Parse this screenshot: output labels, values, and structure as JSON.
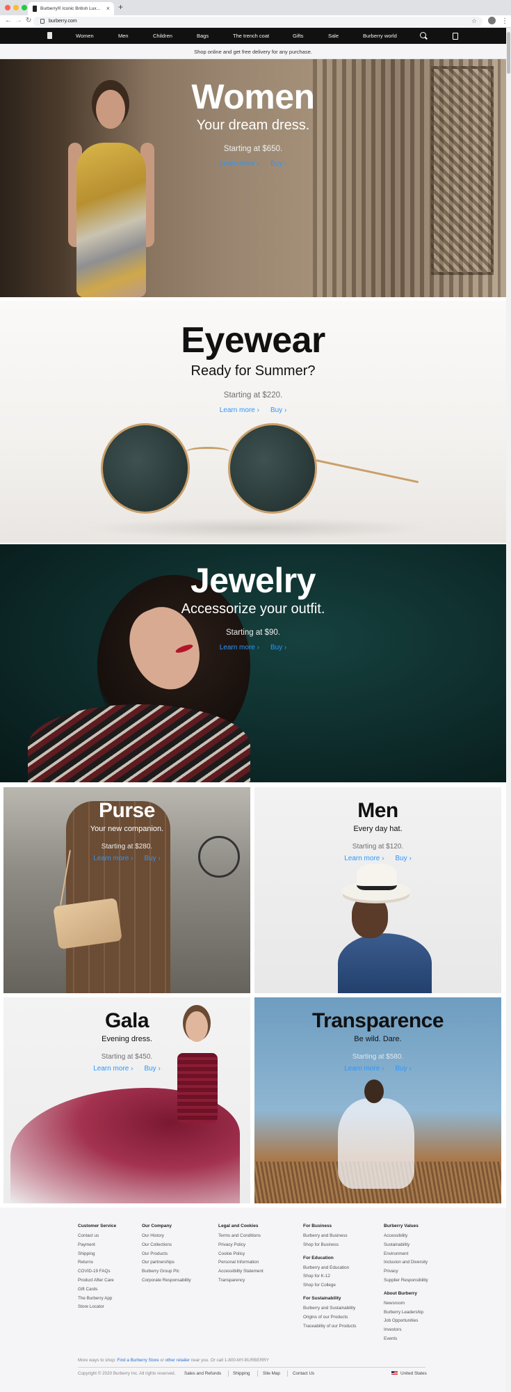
{
  "browser": {
    "tab_title": "Burberry® Iconic British Lux...",
    "url": "burberry.com",
    "traffic_light_colors": [
      "#ff5f57",
      "#febc2e",
      "#28c840"
    ],
    "icons": [
      "back-arrow-icon",
      "forward-arrow-icon",
      "reload-icon",
      "lock-icon",
      "star-icon",
      "profile-icon",
      "kebab-menu-icon"
    ]
  },
  "nav": {
    "items": [
      "Women",
      "Men",
      "Children",
      "Bags",
      "The trench coat",
      "Gifts",
      "Sale",
      "Burberry world"
    ],
    "icons": [
      "brand-logo-icon",
      "search-icon",
      "shopping-bag-icon"
    ]
  },
  "ribbon": "Shop online and get free delivery for any purchase.",
  "accent_color": "#2997ff",
  "heroes": [
    {
      "title": "Women",
      "subtitle": "Your dream dress.",
      "price": "Starting at $650.",
      "learn": "Learn more",
      "buy": "Buy"
    },
    {
      "title": "Eyewear",
      "subtitle": "Ready for Summer?",
      "price": "Starting at $220.",
      "learn": "Learn more",
      "buy": "Buy"
    },
    {
      "title": "Jewelry",
      "subtitle": "Accessorize your outfit.",
      "price": "Starting at $90.",
      "learn": "Learn more",
      "buy": "Buy"
    }
  ],
  "tiles": [
    {
      "title": "Purse",
      "subtitle": "Your new companion.",
      "price": "Starting at $280.",
      "learn": "Learn more",
      "buy": "Buy"
    },
    {
      "title": "Men",
      "subtitle": "Every day hat.",
      "price": "Starting at $120.",
      "learn": "Learn more",
      "buy": "Buy"
    },
    {
      "title": "Gala",
      "subtitle": "Evening dress.",
      "price": "Starting at $450.",
      "learn": "Learn more",
      "buy": "Buy"
    },
    {
      "title": "Transparence",
      "subtitle": "Be wild. Dare.",
      "price": "Starting at $580.",
      "learn": "Learn more",
      "buy": "Buy"
    }
  ],
  "footer": {
    "columns": [
      {
        "heading": "Customer Service",
        "links": [
          "Contact us",
          "Payment",
          "Shipping",
          "Returns",
          "COVID-19 FAQs",
          "Product After Care",
          "Gift Cards",
          "The Burberry App",
          "Store Locator"
        ]
      },
      {
        "heading": "Our Company",
        "links": [
          "Our History",
          "Our Collections",
          "Our Products",
          "Our partnerships",
          "Burberry Group Plc",
          "Corporate Responsability"
        ]
      },
      {
        "heading": "Legal and Cookies",
        "links": [
          "Terms and Conditions",
          "Privacy Policy",
          "Cookie Policy",
          "Personal Information",
          "Accessibility Statement",
          "Transparency"
        ]
      },
      {
        "heading": "For Business",
        "links": [
          "Burberry and Business",
          "Shop for Business"
        ]
      },
      {
        "heading": "For Education",
        "links": [
          "Burberry and Education",
          "Shop for K-12",
          "Shop for College"
        ]
      },
      {
        "heading": "For Sustainability",
        "links": [
          "Burberry and Sustainability",
          "Origins of our Products",
          "Traceability of our Products"
        ]
      },
      {
        "heading": "Burberry Values",
        "links": [
          "Accessibility",
          "Sustainability",
          "Environment",
          "Inclusion and Diversity",
          "Privacy",
          "Supplier Responsibility"
        ]
      },
      {
        "heading": "About Burberry",
        "links": [
          "Newsroom",
          "Burberry Leadership",
          "Job Opportunities",
          "Investors",
          "Events"
        ]
      }
    ],
    "more_ways": {
      "prefix": "More ways to shop: ",
      "link1": "Find a Burberry Store",
      "middle": " or ",
      "link2": "other retailer",
      "suffix": " near you. Or call 1-800-MY-BURBERRY"
    },
    "copyright": "Copyright © 2020 Burberry Inc. All rights reserved.",
    "legal_links": [
      "Sales and Refunds",
      "Shipping",
      "Site Map",
      "Contact Us"
    ],
    "country": "United States"
  }
}
